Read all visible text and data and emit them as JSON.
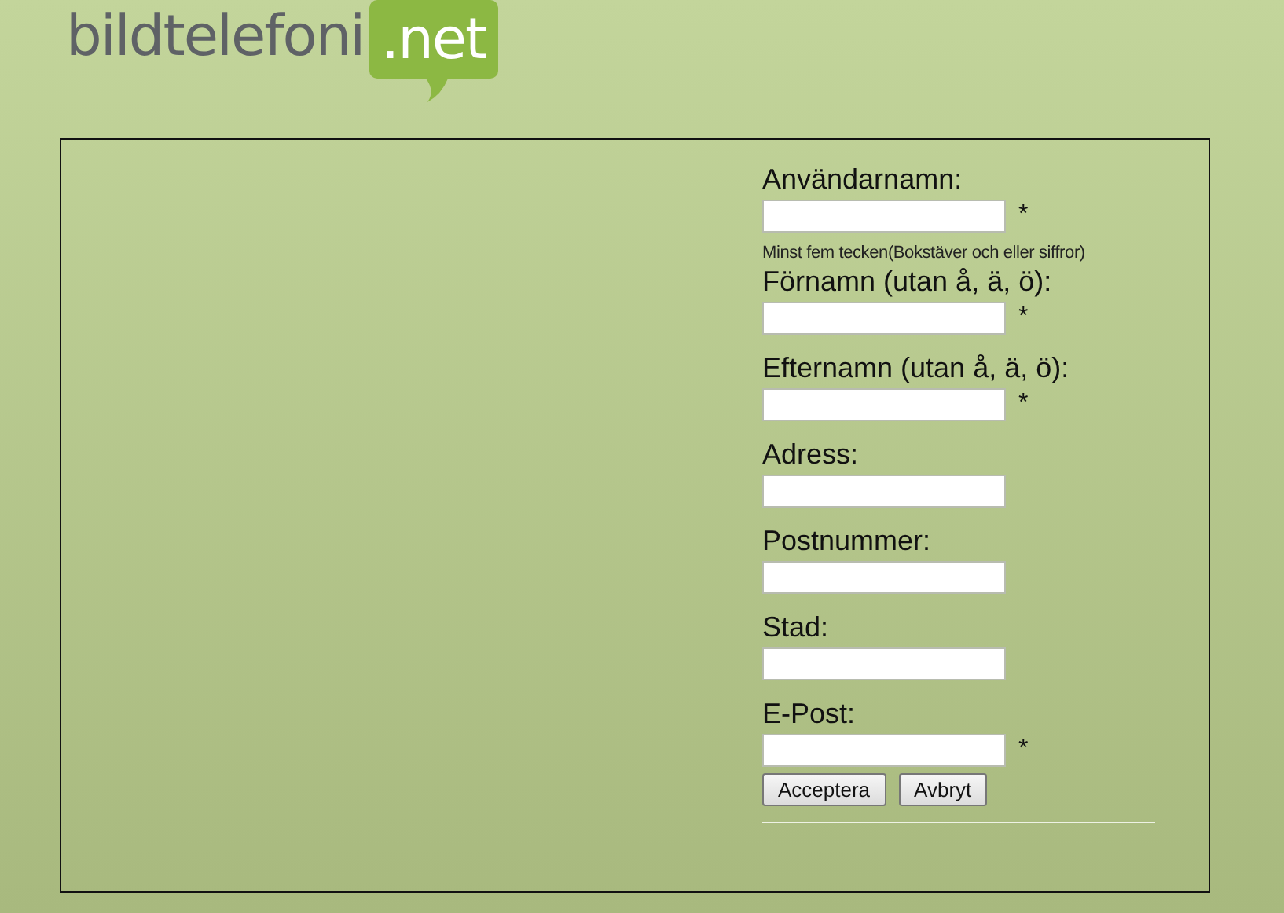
{
  "logo": {
    "name": "bildtelefoni",
    "suffix": ".net"
  },
  "form": {
    "fields": [
      {
        "label": "Användarnamn:",
        "required_mark": "*",
        "hint": "Minst fem tecken(Bokstäver och eller siffror)"
      },
      {
        "label": "Förnamn (utan å, ä, ö):",
        "required_mark": "*"
      },
      {
        "label": "Efternamn (utan å, ä, ö):",
        "required_mark": "*"
      },
      {
        "label": "Adress:"
      },
      {
        "label": "Postnummer:"
      },
      {
        "label": "Stad:"
      },
      {
        "label": "E-Post:",
        "required_mark": "*"
      }
    ],
    "buttons": [
      "Acceptera",
      "Avbryt"
    ]
  }
}
